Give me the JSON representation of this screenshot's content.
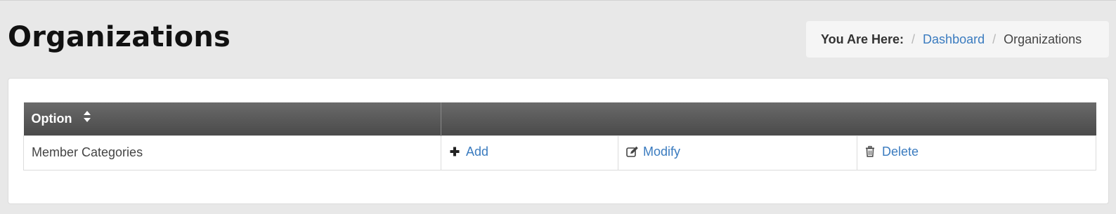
{
  "page": {
    "title": "Organizations"
  },
  "breadcrumb": {
    "label": "You Are Here:",
    "separator": "/",
    "items": [
      "Dashboard",
      "Organizations"
    ]
  },
  "table": {
    "columns": [
      "Option",
      "",
      "",
      ""
    ],
    "rows": [
      {
        "option": "Member Categories",
        "actions": [
          {
            "label": "Add",
            "icon": "plus-icon"
          },
          {
            "label": "Modify",
            "icon": "edit-icon"
          },
          {
            "label": "Delete",
            "icon": "trash-icon"
          }
        ]
      }
    ]
  },
  "colors": {
    "page_bg": "#e8e8e8",
    "panel_bg": "#ffffff",
    "header_bg": "#555555",
    "link": "#3a7bbf"
  }
}
